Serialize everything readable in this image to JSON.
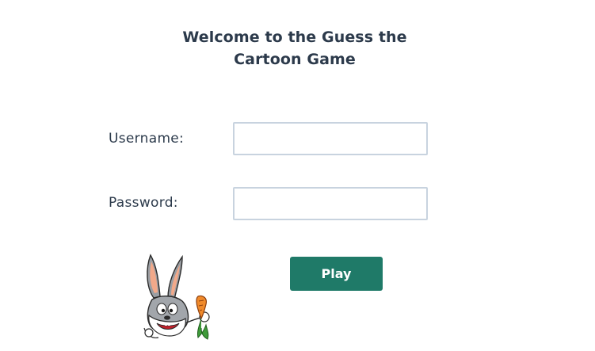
{
  "header": {
    "title_line1": "Welcome to the Guess the",
    "title_line2": "Cartoon Game"
  },
  "form": {
    "username_label": "Username:",
    "username_value": "",
    "password_label": "Password:",
    "password_value": "",
    "play_label": "Play"
  },
  "mascot": {
    "icon": "bugs-bunny-carrot-illustration"
  },
  "colors": {
    "text": "#2c3a4b",
    "button": "#1f7a68",
    "input_border": "#c8d3df"
  }
}
